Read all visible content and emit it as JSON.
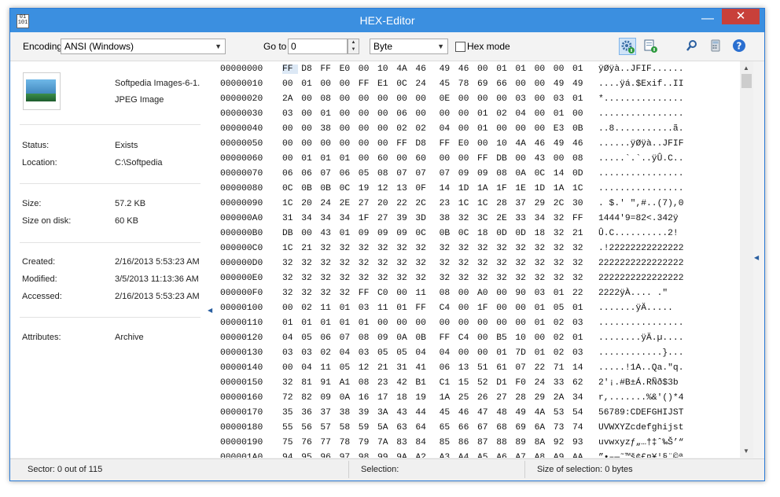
{
  "window": {
    "title": "HEX-Editor",
    "app_icon_text": "01\n101"
  },
  "toolbar": {
    "encoding_label": "Encoding",
    "encoding_value": "ANSI (Windows)",
    "goto_label": "Go to",
    "goto_value": "0",
    "unit_value": "Byte",
    "hexmode_label": "Hex mode",
    "hexmode_checked": false,
    "icons": [
      "settings-info-icon",
      "export-icon",
      "search-icon",
      "calculator-icon",
      "help-icon"
    ]
  },
  "file_info": {
    "name": "Softpedia Images-6-1.",
    "type": "JPEG Image",
    "status_label": "Status:",
    "status": "Exists",
    "location_label": "Location:",
    "location": "C:\\Softpedia",
    "size_label": "Size:",
    "size": "57.2 KB",
    "size_on_disk_label": "Size on disk:",
    "size_on_disk": "60 KB",
    "created_label": "Created:",
    "created": "2/16/2013 5:53:23 AM",
    "modified_label": "Modified:",
    "modified": "3/5/2013 11:13:36 AM",
    "accessed_label": "Accessed:",
    "accessed": "2/16/2013 5:53:23 AM",
    "attributes_label": "Attributes:",
    "attributes": "Archive"
  },
  "hex_rows": [
    {
      "offset": "00000000",
      "bytes": [
        "FF",
        "D8",
        "FF",
        "E0",
        "00",
        "10",
        "4A",
        "46",
        "49",
        "46",
        "00",
        "01",
        "01",
        "00",
        "00",
        "01"
      ],
      "ascii": "ÿØÿà..JFIF......"
    },
    {
      "offset": "00000010",
      "bytes": [
        "00",
        "01",
        "00",
        "00",
        "FF",
        "E1",
        "0C",
        "24",
        "45",
        "78",
        "69",
        "66",
        "00",
        "00",
        "49",
        "49"
      ],
      "ascii": "....ÿá.$Exif..II"
    },
    {
      "offset": "00000020",
      "bytes": [
        "2A",
        "00",
        "08",
        "00",
        "00",
        "00",
        "00",
        "00",
        "0E",
        "00",
        "00",
        "00",
        "03",
        "00",
        "03",
        "01"
      ],
      "ascii": "*..............."
    },
    {
      "offset": "00000030",
      "bytes": [
        "03",
        "00",
        "01",
        "00",
        "00",
        "00",
        "06",
        "00",
        "00",
        "00",
        "01",
        "02",
        "04",
        "00",
        "01",
        "00"
      ],
      "ascii": "................"
    },
    {
      "offset": "00000040",
      "bytes": [
        "00",
        "00",
        "38",
        "00",
        "00",
        "00",
        "02",
        "02",
        "04",
        "00",
        "01",
        "00",
        "00",
        "00",
        "E3",
        "0B"
      ],
      "ascii": "..8...........ã."
    },
    {
      "offset": "00000050",
      "bytes": [
        "00",
        "00",
        "00",
        "00",
        "00",
        "00",
        "FF",
        "D8",
        "FF",
        "E0",
        "00",
        "10",
        "4A",
        "46",
        "49",
        "46"
      ],
      "ascii": "......ÿØÿà..JFIF"
    },
    {
      "offset": "00000060",
      "bytes": [
        "00",
        "01",
        "01",
        "01",
        "00",
        "60",
        "00",
        "60",
        "00",
        "00",
        "FF",
        "DB",
        "00",
        "43",
        "00",
        "08"
      ],
      "ascii": ".....`.`..ÿÛ.C.."
    },
    {
      "offset": "00000070",
      "bytes": [
        "06",
        "06",
        "07",
        "06",
        "05",
        "08",
        "07",
        "07",
        "07",
        "09",
        "09",
        "08",
        "0A",
        "0C",
        "14",
        "0D"
      ],
      "ascii": "................"
    },
    {
      "offset": "00000080",
      "bytes": [
        "0C",
        "0B",
        "0B",
        "0C",
        "19",
        "12",
        "13",
        "0F",
        "14",
        "1D",
        "1A",
        "1F",
        "1E",
        "1D",
        "1A",
        "1C"
      ],
      "ascii": "................"
    },
    {
      "offset": "00000090",
      "bytes": [
        "1C",
        "20",
        "24",
        "2E",
        "27",
        "20",
        "22",
        "2C",
        "23",
        "1C",
        "1C",
        "28",
        "37",
        "29",
        "2C",
        "30"
      ],
      "ascii": ". $.' \",#..(7),0"
    },
    {
      "offset": "000000A0",
      "bytes": [
        "31",
        "34",
        "34",
        "34",
        "1F",
        "27",
        "39",
        "3D",
        "38",
        "32",
        "3C",
        "2E",
        "33",
        "34",
        "32",
        "FF"
      ],
      "ascii": "1444'9=82<.342ÿ"
    },
    {
      "offset": "000000B0",
      "bytes": [
        "DB",
        "00",
        "43",
        "01",
        "09",
        "09",
        "09",
        "0C",
        "0B",
        "0C",
        "18",
        "0D",
        "0D",
        "18",
        "32",
        "21"
      ],
      "ascii": "Û.C..........2!"
    },
    {
      "offset": "000000C0",
      "bytes": [
        "1C",
        "21",
        "32",
        "32",
        "32",
        "32",
        "32",
        "32",
        "32",
        "32",
        "32",
        "32",
        "32",
        "32",
        "32",
        "32"
      ],
      "ascii": ".!22222222222222"
    },
    {
      "offset": "000000D0",
      "bytes": [
        "32",
        "32",
        "32",
        "32",
        "32",
        "32",
        "32",
        "32",
        "32",
        "32",
        "32",
        "32",
        "32",
        "32",
        "32",
        "32"
      ],
      "ascii": "2222222222222222"
    },
    {
      "offset": "000000E0",
      "bytes": [
        "32",
        "32",
        "32",
        "32",
        "32",
        "32",
        "32",
        "32",
        "32",
        "32",
        "32",
        "32",
        "32",
        "32",
        "32",
        "32"
      ],
      "ascii": "2222222222222222"
    },
    {
      "offset": "000000F0",
      "bytes": [
        "32",
        "32",
        "32",
        "32",
        "FF",
        "C0",
        "00",
        "11",
        "08",
        "00",
        "A0",
        "00",
        "90",
        "03",
        "01",
        "22"
      ],
      "ascii": "2222ÿÀ.... .\""
    },
    {
      "offset": "00000100",
      "bytes": [
        "00",
        "02",
        "11",
        "01",
        "03",
        "11",
        "01",
        "FF",
        "C4",
        "00",
        "1F",
        "00",
        "00",
        "01",
        "05",
        "01"
      ],
      "ascii": ".......ÿÄ....."
    },
    {
      "offset": "00000110",
      "bytes": [
        "01",
        "01",
        "01",
        "01",
        "01",
        "00",
        "00",
        "00",
        "00",
        "00",
        "00",
        "00",
        "00",
        "01",
        "02",
        "03"
      ],
      "ascii": "................"
    },
    {
      "offset": "00000120",
      "bytes": [
        "04",
        "05",
        "06",
        "07",
        "08",
        "09",
        "0A",
        "0B",
        "FF",
        "C4",
        "00",
        "B5",
        "10",
        "00",
        "02",
        "01"
      ],
      "ascii": "........ÿÄ.µ...."
    },
    {
      "offset": "00000130",
      "bytes": [
        "03",
        "03",
        "02",
        "04",
        "03",
        "05",
        "05",
        "04",
        "04",
        "00",
        "00",
        "01",
        "7D",
        "01",
        "02",
        "03"
      ],
      "ascii": "............}..."
    },
    {
      "offset": "00000140",
      "bytes": [
        "00",
        "04",
        "11",
        "05",
        "12",
        "21",
        "31",
        "41",
        "06",
        "13",
        "51",
        "61",
        "07",
        "22",
        "71",
        "14"
      ],
      "ascii": ".....!1A..Qa.\"q."
    },
    {
      "offset": "00000150",
      "bytes": [
        "32",
        "81",
        "91",
        "A1",
        "08",
        "23",
        "42",
        "B1",
        "C1",
        "15",
        "52",
        "D1",
        "F0",
        "24",
        "33",
        "62"
      ],
      "ascii": "2'¡.#B±Á.RÑð$3b"
    },
    {
      "offset": "00000160",
      "bytes": [
        "72",
        "82",
        "09",
        "0A",
        "16",
        "17",
        "18",
        "19",
        "1A",
        "25",
        "26",
        "27",
        "28",
        "29",
        "2A",
        "34"
      ],
      "ascii": "r,.......%&'()*4"
    },
    {
      "offset": "00000170",
      "bytes": [
        "35",
        "36",
        "37",
        "38",
        "39",
        "3A",
        "43",
        "44",
        "45",
        "46",
        "47",
        "48",
        "49",
        "4A",
        "53",
        "54"
      ],
      "ascii": "56789:CDEFGHIJST"
    },
    {
      "offset": "00000180",
      "bytes": [
        "55",
        "56",
        "57",
        "58",
        "59",
        "5A",
        "63",
        "64",
        "65",
        "66",
        "67",
        "68",
        "69",
        "6A",
        "73",
        "74"
      ],
      "ascii": "UVWXYZcdefghijst"
    },
    {
      "offset": "00000190",
      "bytes": [
        "75",
        "76",
        "77",
        "78",
        "79",
        "7A",
        "83",
        "84",
        "85",
        "86",
        "87",
        "88",
        "89",
        "8A",
        "92",
        "93"
      ],
      "ascii": "uvwxyzƒ„…†‡ˆ‰Š’“"
    },
    {
      "offset": "000001A0",
      "bytes": [
        "94",
        "95",
        "96",
        "97",
        "98",
        "99",
        "9A",
        "A2",
        "A3",
        "A4",
        "A5",
        "A6",
        "A7",
        "A8",
        "A9",
        "AA"
      ],
      "ascii": "”•–—˜™š¢£¤¥¦§¨©ª"
    }
  ],
  "status": {
    "sector": "Sector: 0 out of 115",
    "selection": "Selection:",
    "size_of_selection": "Size of selection: 0 bytes"
  }
}
